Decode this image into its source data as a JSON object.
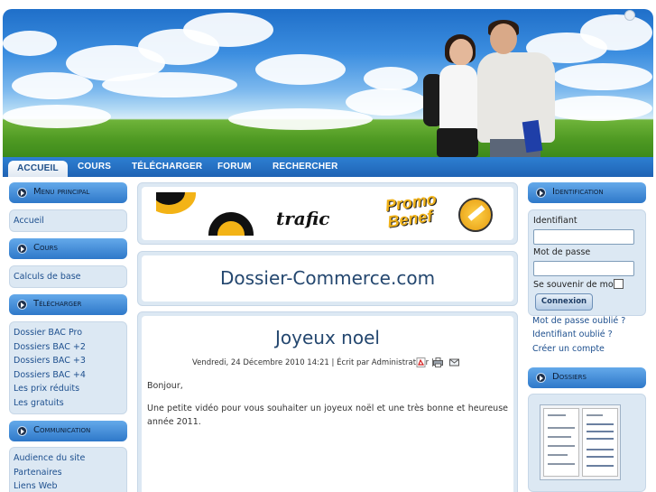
{
  "nav": {
    "items": [
      "ACCUEIL",
      "COURS",
      "TÉLÉCHARGER",
      "FORUM",
      "RECHERCHER"
    ],
    "active": "ACCUEIL"
  },
  "left_menu": {
    "menu_principal": {
      "title": "Menu principal",
      "items": [
        "Accueil"
      ]
    },
    "cours": {
      "title": "Cours",
      "items": [
        "Calculs de base"
      ]
    },
    "telecharger": {
      "title": "Télécharger",
      "items": [
        "Dossier BAC Pro",
        "Dossiers BAC +2",
        "Dossiers BAC +3",
        "Dossiers BAC +4",
        "Les prix réduits",
        "Les gratuits"
      ]
    },
    "communication": {
      "title": "Communication",
      "items": [
        "Audience du site",
        "Partenaires",
        "Liens Web"
      ]
    }
  },
  "ad": {
    "word1": "trafic",
    "word2": "Promo",
    "word3": "Benef"
  },
  "site_title": "Dossier-Commerce.com",
  "article": {
    "title": "Joyeux noel",
    "meta": "Vendredi, 24 Décembre 2010 14:21 | Écrit par Administrateur |",
    "icons": [
      "pdf-icon",
      "print-icon",
      "email-icon"
    ],
    "greeting": "Bonjour,",
    "body": "Une petite vidéo pour vous souhaiter un joyeux noël et une très bonne et heureuse année 2011."
  },
  "login": {
    "title": "Identification",
    "username_label": "Identifiant",
    "password_label": "Mot de passe",
    "remember_label": "Se souvenir de moi",
    "button": "Connexion",
    "links": [
      "Mot de passe oublié ?",
      "Identifiant oublié ?",
      "Créer un compte"
    ]
  },
  "dossiers": {
    "title": "Dossiers"
  },
  "colors": {
    "accent": "#2e78c9",
    "title_text": "#24476f",
    "link": "#1d4f8e",
    "box_bg": "#dce8f3"
  }
}
